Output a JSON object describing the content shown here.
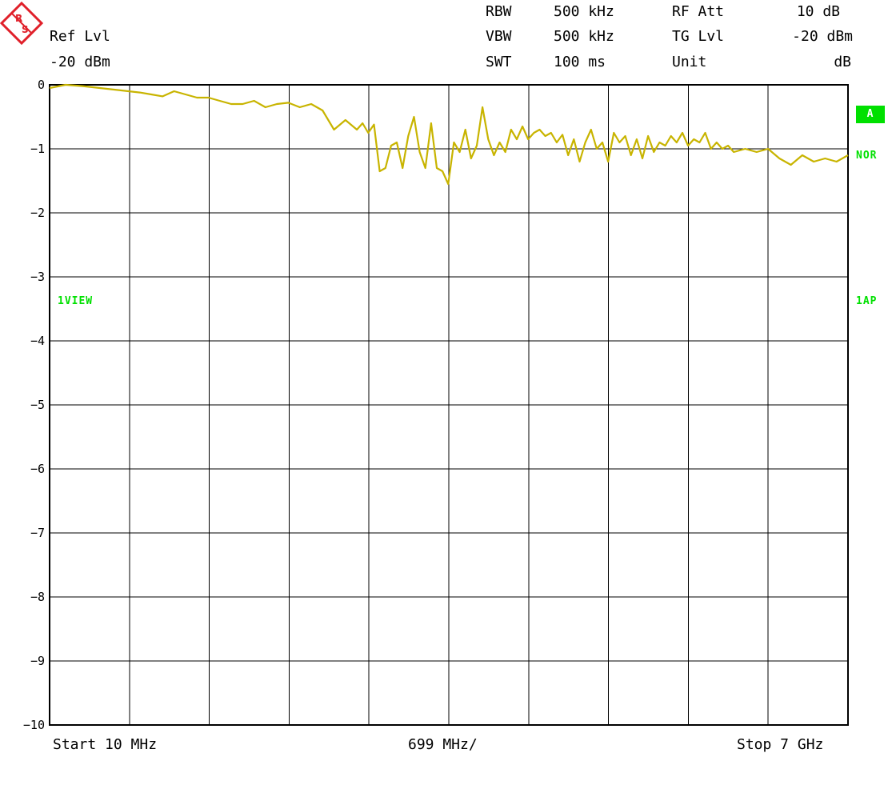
{
  "header": {
    "ref_lvl_label": "Ref Lvl",
    "ref_lvl_value": "-20 dBm",
    "rbw_label": "RBW",
    "rbw_value": "500 kHz",
    "vbw_label": "VBW",
    "vbw_value": "500 kHz",
    "swt_label": "SWT",
    "swt_value": "100 ms",
    "rfatt_label": "RF Att",
    "rfatt_value": "10 dB",
    "tglvl_label": "TG Lvl",
    "tglvl_value": "-20 dBm",
    "unit_label": "Unit",
    "unit_value": "dB"
  },
  "side_tags": {
    "a": "A",
    "nor": "NOR",
    "view": "1VIEW",
    "ap": "1AP"
  },
  "footer": {
    "start": "Start 10 MHz",
    "span": "699 MHz/",
    "stop": "Stop 7 GHz"
  },
  "colors": {
    "trace": "#c8b400",
    "grid": "#000000",
    "tag_green": "#00e000",
    "logo_red": "#e0202a"
  },
  "chart_data": {
    "type": "line",
    "title": "",
    "xlabel": "",
    "ylabel": "",
    "x_unit": "MHz",
    "xlim": [
      10,
      7000
    ],
    "ylim": [
      -10,
      0
    ],
    "y_ticks": [
      0,
      -1,
      -2,
      -3,
      -4,
      -5,
      -6,
      -7,
      -8,
      -9,
      -10
    ],
    "y_tick_labels": [
      "0",
      "−1",
      "−2",
      "−3",
      "−4",
      "−5",
      "−6",
      "−7",
      "−8",
      "−9",
      "−10"
    ],
    "x_divisions": 10,
    "grid": true,
    "series": [
      {
        "x": [
          10,
          150,
          300,
          450,
          600,
          700,
          800,
          900,
          1000,
          1100,
          1200,
          1300,
          1400,
          1500,
          1600,
          1700,
          1800,
          1900,
          2000,
          2100,
          2200,
          2300,
          2400,
          2500,
          2600,
          2700,
          2750,
          2800,
          2850,
          2900,
          2950,
          3000,
          3050,
          3100,
          3150,
          3200,
          3250,
          3300,
          3350,
          3400,
          3450,
          3500,
          3550,
          3600,
          3650,
          3700,
          3750,
          3800,
          3850,
          3900,
          3950,
          4000,
          4050,
          4100,
          4150,
          4200,
          4250,
          4300,
          4350,
          4400,
          4450,
          4500,
          4550,
          4600,
          4650,
          4700,
          4750,
          4800,
          4850,
          4900,
          4950,
          5000,
          5050,
          5100,
          5150,
          5200,
          5250,
          5300,
          5350,
          5400,
          5450,
          5500,
          5550,
          5600,
          5650,
          5700,
          5750,
          5800,
          5850,
          5900,
          5950,
          6000,
          6100,
          6200,
          6300,
          6400,
          6500,
          6600,
          6700,
          6800,
          6900,
          7000
        ],
        "y": [
          -0.05,
          0.0,
          -0.02,
          -0.05,
          -0.08,
          -0.1,
          -0.12,
          -0.15,
          -0.18,
          -0.1,
          -0.15,
          -0.2,
          -0.2,
          -0.25,
          -0.3,
          -0.3,
          -0.25,
          -0.35,
          -0.3,
          -0.28,
          -0.35,
          -0.3,
          -0.4,
          -0.7,
          -0.55,
          -0.7,
          -0.6,
          -0.75,
          -0.62,
          -1.35,
          -1.3,
          -0.95,
          -0.9,
          -1.3,
          -0.8,
          -0.5,
          -1.05,
          -1.3,
          -0.6,
          -1.3,
          -1.35,
          -1.55,
          -0.9,
          -1.05,
          -0.7,
          -1.15,
          -0.95,
          -0.35,
          -0.85,
          -1.1,
          -0.9,
          -1.05,
          -0.7,
          -0.85,
          -0.65,
          -0.85,
          -0.75,
          -0.7,
          -0.8,
          -0.75,
          -0.9,
          -0.78,
          -1.1,
          -0.85,
          -1.2,
          -0.9,
          -0.7,
          -1.0,
          -0.9,
          -1.2,
          -0.75,
          -0.9,
          -0.8,
          -1.1,
          -0.85,
          -1.15,
          -0.8,
          -1.05,
          -0.9,
          -0.95,
          -0.8,
          -0.9,
          -0.75,
          -0.95,
          -0.85,
          -0.9,
          -0.75,
          -1.0,
          -0.9,
          -1.0,
          -0.95,
          -1.05,
          -1.0,
          -1.05,
          -1.0,
          -1.15,
          -1.25,
          -1.1,
          -1.2,
          -1.15,
          -1.2,
          -1.1
        ]
      }
    ]
  }
}
